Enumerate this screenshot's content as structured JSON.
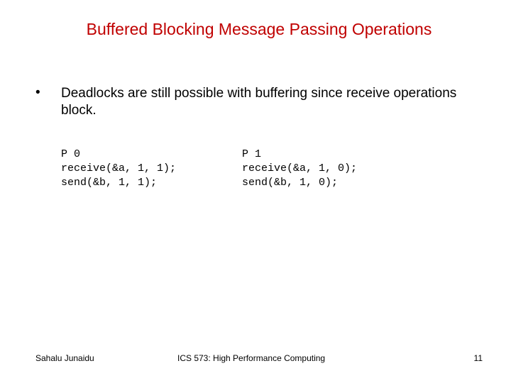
{
  "title": "Buffered Blocking Message Passing Operations",
  "bullet": {
    "text": "Deadlocks are still possible with buffering since receive operations block."
  },
  "code": {
    "left": {
      "label": "P 0",
      "line1": "receive(&a, 1, 1);",
      "line2": "send(&b, 1, 1);"
    },
    "right": {
      "label": "P 1",
      "line1": "receive(&a, 1, 0);",
      "line2": "send(&b, 1, 0);"
    }
  },
  "footer": {
    "author": "Sahalu Junaidu",
    "course": "ICS 573: High Performance Computing",
    "page": "11"
  }
}
